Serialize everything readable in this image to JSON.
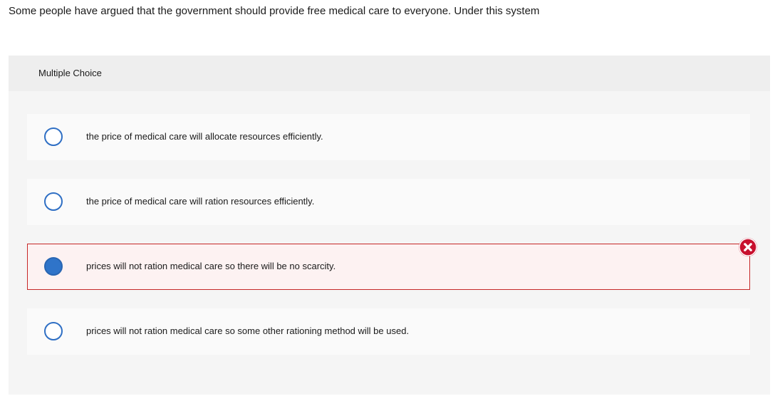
{
  "question": {
    "text": "Some people have argued that the government should provide free medical care to everyone. Under this system"
  },
  "panel": {
    "header_label": "Multiple Choice"
  },
  "options": [
    {
      "label": "the price of medical care will allocate resources efficiently.",
      "selected": false
    },
    {
      "label": "the price of medical care will ration resources efficiently.",
      "selected": false
    },
    {
      "label": "prices will not ration medical care so there will be no scarcity.",
      "selected": true,
      "status": "incorrect"
    },
    {
      "label": "prices will not ration medical care so some other rationing method will be used.",
      "selected": false
    }
  ],
  "icons": {
    "incorrect": "close-circle-icon"
  },
  "colors": {
    "radio_border": "#2f6fc4",
    "radio_selected_fill": "#2f74c9",
    "incorrect_border": "#c62828",
    "incorrect_background": "#fdf2f2",
    "incorrect_icon": "#c8102e"
  }
}
